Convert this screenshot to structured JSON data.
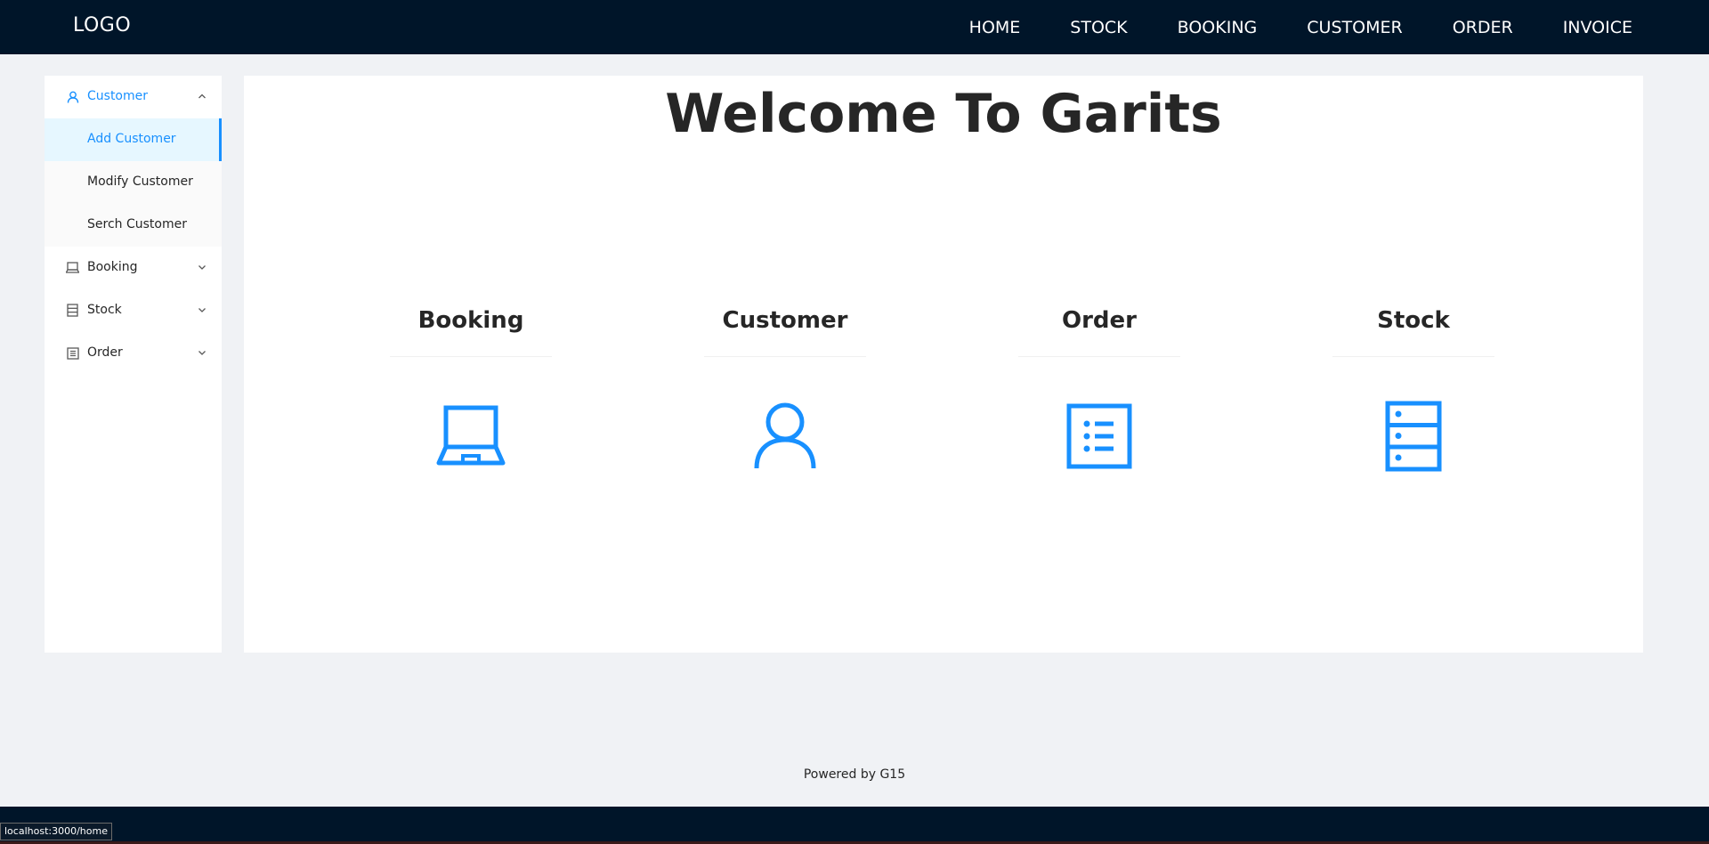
{
  "header": {
    "logo": "LOGO",
    "nav": [
      "HOME",
      "STOCK",
      "BOOKING",
      "CUSTOMER",
      "ORDER",
      "INVOICE"
    ]
  },
  "sidebar": {
    "customer": {
      "label": "Customer",
      "icon": "user-icon",
      "expanded": true
    },
    "customer_items": [
      "Add Customer",
      "Modify Customer",
      "Serch Customer"
    ],
    "selected_item": "Add Customer",
    "booking": {
      "label": "Booking",
      "icon": "laptop-icon"
    },
    "stock": {
      "label": "Stock",
      "icon": "database-icon"
    },
    "order": {
      "label": "Order",
      "icon": "profile-icon"
    }
  },
  "main": {
    "title": "Welcome To Garits",
    "cards": [
      {
        "title": "Booking",
        "icon": "laptop-icon"
      },
      {
        "title": "Customer",
        "icon": "user-icon"
      },
      {
        "title": "Order",
        "icon": "profile-icon"
      },
      {
        "title": "Stock",
        "icon": "database-icon"
      }
    ]
  },
  "footer": {
    "text": "Powered by G15"
  },
  "status": {
    "url": "localhost:3000/home"
  },
  "colors": {
    "header_bg": "#001529",
    "accent": "#1890ff",
    "page_bg": "#f0f2f5"
  }
}
